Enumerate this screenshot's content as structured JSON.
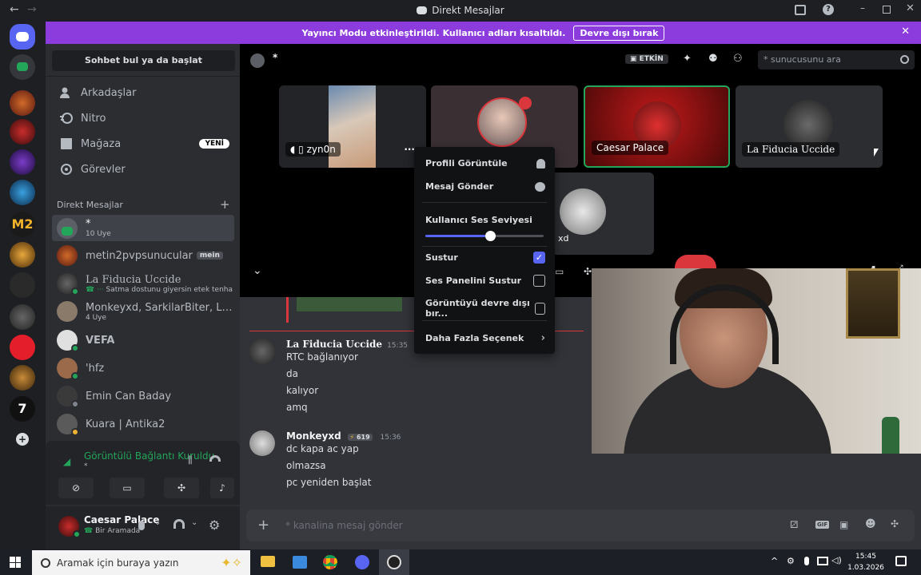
{
  "window": {
    "title": "Direkt Mesajlar"
  },
  "banner": {
    "text": "Yayıncı Modu etkinleştirildi. Kullanıcı adları kısaltıldı.",
    "button": "Devre dışı bırak"
  },
  "sidebar": {
    "search": "Sohbet bul ya da başlat",
    "nav": [
      "Arkadaşlar",
      "Nitro",
      "Mağaza",
      "Görevler"
    ],
    "new_badge": "YENİ",
    "dm_header": "Direkt Mesajlar",
    "dms": [
      {
        "name": "*",
        "sub": "10 Üye"
      },
      {
        "name": "metin2pvpsunucular",
        "tag": "mein"
      },
      {
        "name": "La Fiducia Uccide",
        "sub": "Satma dostunu giyersin etek tenha c"
      },
      {
        "name": "Monkeyxd, SarkilarBiter, La ...",
        "sub": "4 Üye"
      },
      {
        "name": "VEFA"
      },
      {
        "name": "'hfz"
      },
      {
        "name": "Emin Can Baday"
      },
      {
        "name": "Kuara | Antika2"
      }
    ]
  },
  "voice": {
    "status": "Görüntülü Bağlantı Kuruldu",
    "channel": "*"
  },
  "user": {
    "name": "Caesar Palace",
    "status": "Bir Aramada"
  },
  "header": {
    "channel": "*",
    "active_badge": "ETKİN",
    "search_placeholder": "* sunucusunu ara"
  },
  "tiles": [
    {
      "label": "zyn0n"
    },
    {
      "label": ""
    },
    {
      "label": "Caesar Palace"
    },
    {
      "label": "La Fiducia Uccide"
    },
    {
      "label": "xd"
    }
  ],
  "context_menu": {
    "profile": "Profili Görüntüle",
    "message": "Mesaj Gönder",
    "volume_label": "Kullanıcı Ses Seviyesi",
    "volume": 0.55,
    "mute": "Sustur",
    "soundboard": "Ses Panelini Sustur",
    "disable_video": "Görüntüyü devre dışı bır...",
    "more": "Daha Fazla Seçenek"
  },
  "messages": [
    {
      "author": "La Fiducia Uccide",
      "time": "15:35",
      "lines": [
        "RTC bağlanıyor",
        "da",
        "kalıyor",
        "amq"
      ]
    },
    {
      "author": "Monkeyxd",
      "badge": "619",
      "time": "15:36",
      "lines": [
        "dc kapa ac yap",
        "olmazsa",
        "pc yeniden başlat"
      ]
    }
  ],
  "composer": {
    "placeholder": "* kanalina mesaj gönder"
  },
  "taskbar": {
    "search": "Aramak için buraya yazın",
    "time": "15:45",
    "date": "1.03.2026"
  },
  "colors": {
    "accent": "#5865f2",
    "banner": "#8c3cdd",
    "online": "#23a55a",
    "red": "#da373c"
  }
}
